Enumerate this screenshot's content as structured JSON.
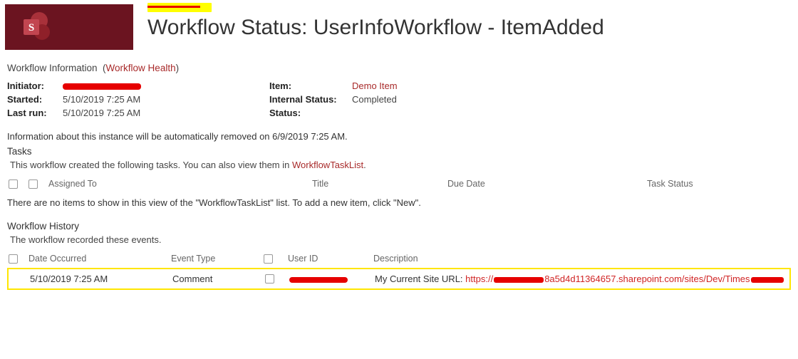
{
  "header": {
    "breadcrumb_redacted": true,
    "title": "Workflow Status: UserInfoWorkflow - ItemAdded"
  },
  "info": {
    "section_label": "Workflow Information",
    "health_link": "Workflow Health",
    "left": {
      "initiator_label": "Initiator:",
      "initiator_value_redacted": true,
      "started_label": "Started:",
      "started_value": "5/10/2019 7:25 AM",
      "lastrun_label": "Last run:",
      "lastrun_value": "5/10/2019 7:25 AM"
    },
    "right": {
      "item_label": "Item:",
      "item_value": "Demo Item",
      "internal_status_label": "Internal Status:",
      "internal_status_value": "Completed",
      "status_label": "Status:",
      "status_value": ""
    },
    "auto_remove": "Information about this instance will be automatically removed on 6/9/2019 7:25 AM."
  },
  "tasks": {
    "title": "Tasks",
    "desc_prefix": "This workflow created the following tasks. You can also view them in ",
    "desc_link": "WorkflowTaskList",
    "desc_suffix": ".",
    "cols": {
      "assigned": "Assigned To",
      "title": "Title",
      "due": "Due Date",
      "status": "Task Status"
    },
    "empty": "There are no items to show in this view of the \"WorkflowTaskList\" list. To add a new item, click \"New\"."
  },
  "history": {
    "title": "Workflow History",
    "desc": "The workflow recorded these events.",
    "cols": {
      "date": "Date Occurred",
      "type": "Event Type",
      "user": "User ID",
      "desc": "Description"
    },
    "row": {
      "date": "5/10/2019 7:25 AM",
      "type": "Comment",
      "user_redacted": true,
      "desc_prefix": "My Current Site URL: ",
      "url_scheme": "https://",
      "url_mid_redacted": true,
      "url_tail": "8a5d4d11364657.sharepoint.com/sites/Dev/Times"
    }
  }
}
